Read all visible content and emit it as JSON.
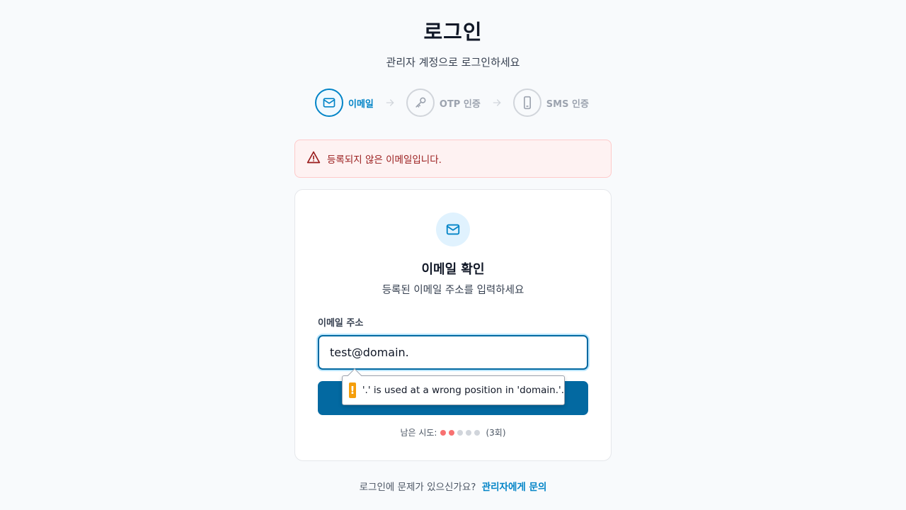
{
  "header": {
    "title": "로그인",
    "subtitle": "관리자 계정으로 로그인하세요"
  },
  "steps": [
    {
      "label": "이메일",
      "icon": "mail-icon",
      "active": true
    },
    {
      "label": "OTP 인증",
      "icon": "key-icon",
      "active": false
    },
    {
      "label": "SMS 인증",
      "icon": "smartphone-icon",
      "active": false
    }
  ],
  "alert": {
    "icon": "warning-triangle-icon",
    "message": "등록되지 않은 이메일입니다."
  },
  "card": {
    "icon": "mail-icon",
    "title": "이메일 확인",
    "description": "등록된 이메일 주소를 입력하세요",
    "field_label": "이메일 주소",
    "email_value": "test@domain.",
    "submit_label": "",
    "attempts": {
      "label": "남은 시도:",
      "used": 2,
      "total": 5,
      "count_text": "(3회)"
    }
  },
  "tooltip": {
    "icon": "exclamation-icon",
    "message": "'.' is used at a wrong position in 'domain.'."
  },
  "footer": {
    "text": "로그인에 문제가 있으신가요?",
    "link": "관리자에게 문의"
  },
  "colors": {
    "accent": "#0284c7",
    "button": "#0369a1",
    "error_bg": "#fef2f2",
    "error_text": "#991b1b",
    "attempt_used": "#f87171",
    "attempt_remaining": "#d1d5db",
    "warning": "#f59e0b"
  }
}
